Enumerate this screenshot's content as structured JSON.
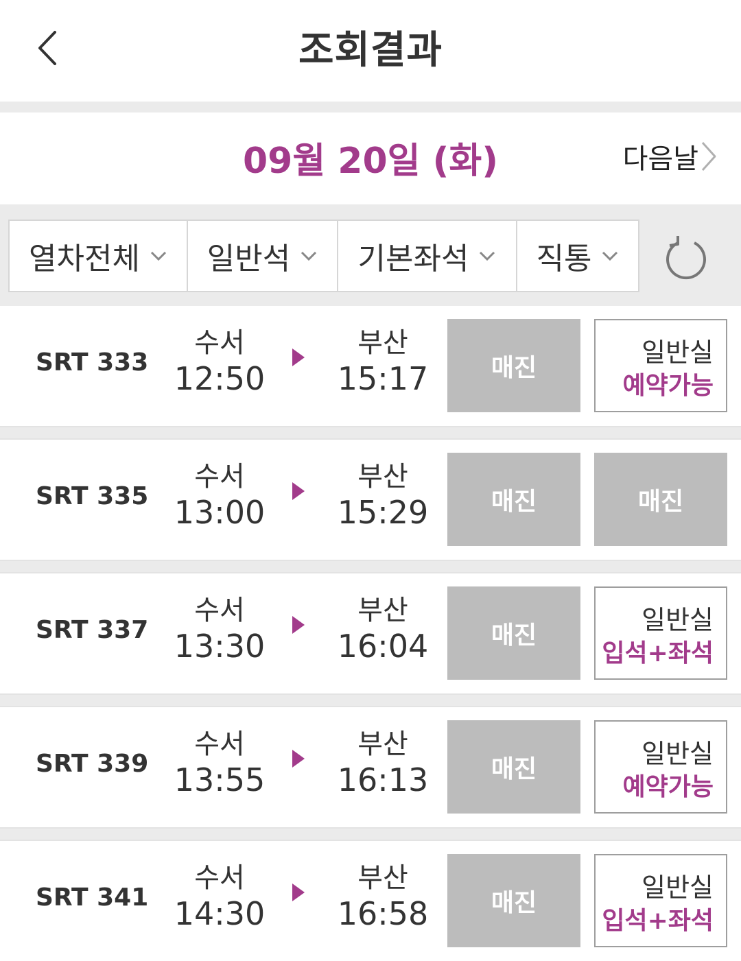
{
  "header": {
    "title": "조회결과",
    "back_icon": "chevron-left-icon"
  },
  "date_bar": {
    "date": "09월 20일 (화)",
    "next_label": "다음날"
  },
  "filters": [
    {
      "label": "열차전체"
    },
    {
      "label": "일반석"
    },
    {
      "label": "기본좌석"
    },
    {
      "label": "직통"
    }
  ],
  "refresh_icon": "refresh-icon",
  "colors": {
    "accent": "#a23b8b",
    "soldout_bg": "#bcbcbc",
    "band": "#ebebeb"
  },
  "trains": [
    {
      "train": "SRT 333",
      "dep_station": "수서",
      "dep_time": "12:50",
      "arr_station": "부산",
      "arr_time": "15:17",
      "special": "매진",
      "general_status": "available",
      "general_top": "일반실",
      "general_bottom": "예약가능"
    },
    {
      "train": "SRT 335",
      "dep_station": "수서",
      "dep_time": "13:00",
      "arr_station": "부산",
      "arr_time": "15:29",
      "special": "매진",
      "general_status": "soldout",
      "general_label": "매진"
    },
    {
      "train": "SRT 337",
      "dep_station": "수서",
      "dep_time": "13:30",
      "arr_station": "부산",
      "arr_time": "16:04",
      "special": "매진",
      "general_status": "available",
      "general_top": "일반실",
      "general_bottom": "입석+좌석"
    },
    {
      "train": "SRT 339",
      "dep_station": "수서",
      "dep_time": "13:55",
      "arr_station": "부산",
      "arr_time": "16:13",
      "special": "매진",
      "general_status": "available",
      "general_top": "일반실",
      "general_bottom": "예약가능"
    },
    {
      "train": "SRT 341",
      "dep_station": "수서",
      "dep_time": "14:30",
      "arr_station": "부산",
      "arr_time": "16:58",
      "special": "매진",
      "general_status": "available",
      "general_top": "일반실",
      "general_bottom": "입석+좌석"
    }
  ]
}
